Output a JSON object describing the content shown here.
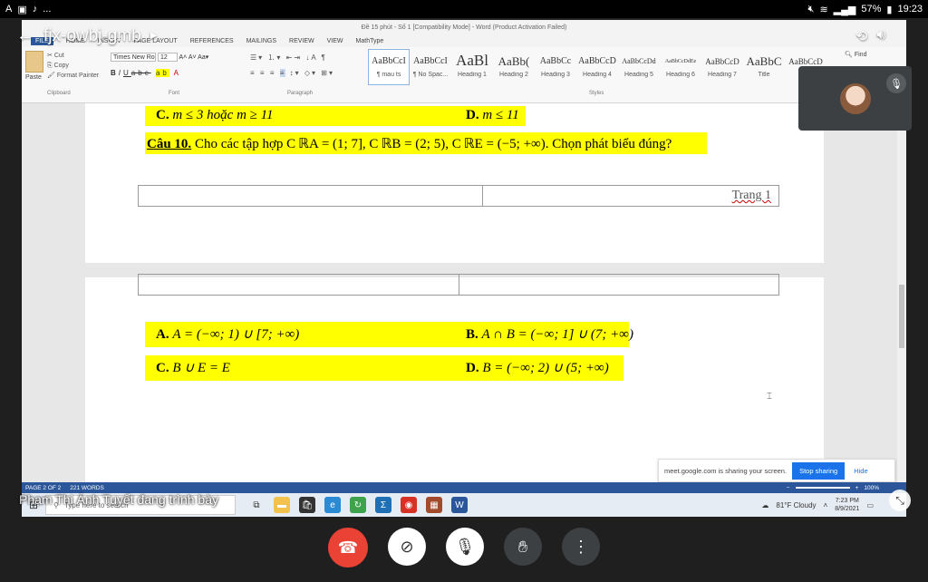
{
  "status_bar": {
    "left_icons": [
      "A",
      "▣",
      "♪",
      "..."
    ],
    "battery": "57%",
    "time": "19:23"
  },
  "meet": {
    "meeting_code": "fjx-owbj-gmb",
    "presenter_text": "Phạm Thị Ánh Tuyết đang trình bày"
  },
  "word": {
    "title": "Đề 15 phút - Số 1 [Compatibility Mode] - Word (Product Activation Failed)",
    "tabs": [
      "FILE",
      "HOME",
      "INSERT",
      "PAGE LAYOUT",
      "REFERENCES",
      "MAILINGS",
      "REVIEW",
      "VIEW",
      "MathType"
    ],
    "clipboard": {
      "paste": "Paste",
      "cut": "Cut",
      "copy": "Copy",
      "format_painter": "Format Painter",
      "label": "Clipboard"
    },
    "font": {
      "name": "Times New Ro",
      "size": "12",
      "label": "Font"
    },
    "paragraph_label": "Paragraph",
    "styles_label": "Styles",
    "styles": [
      {
        "sample": "AaBbCcI",
        "name": "¶ mau ts"
      },
      {
        "sample": "AaBbCcI",
        "name": "¶ No Spac..."
      },
      {
        "sample": "AaBl",
        "name": "Heading 1"
      },
      {
        "sample": "AaBb(",
        "name": "Heading 2"
      },
      {
        "sample": "AaBbCc",
        "name": "Heading 3"
      },
      {
        "sample": "AaBbCcD",
        "name": "Heading 4"
      },
      {
        "sample": "AaBbCcDd",
        "name": "Heading 5"
      },
      {
        "sample": "AaBbCcDdEe",
        "name": "Heading 6"
      },
      {
        "sample": "AaBbCcD",
        "name": "Heading 7"
      },
      {
        "sample": "AaBbC",
        "name": "Title"
      },
      {
        "sample": "AaBbCcD",
        "name": "Su"
      }
    ],
    "find": "Find",
    "page1": {
      "option_c_label": "C.",
      "option_c_text": "m ≤ 3  hoặc  m ≥ 11",
      "option_d_label": "D.",
      "option_d_text": "m ≤ 11",
      "question_label": "Câu 10.",
      "question_text": "Cho các tập hợp C ℝA = (1; 7], C ℝB = (2; 5), C ℝE = (−5; +∞). Chọn phát biểu đúng?",
      "footer_page": "Trang 1"
    },
    "page2": {
      "a_label": "A.",
      "a_text": "A = (−∞; 1) ∪ [7; +∞)",
      "b_label": "B.",
      "b_text": "A ∩ B = (−∞; 1] ∪ (7; +∞)",
      "c_label": "C.",
      "c_text": "B ∪ E = E",
      "d_label": "D.",
      "d_text": "B = (−∞; 2) ∪ (5; +∞)"
    },
    "status": {
      "page": "PAGE 2 OF 2",
      "words": "221 WORDS",
      "zoom": "100%"
    }
  },
  "share_banner": {
    "text": "meet.google.com is sharing your screen.",
    "stop": "Stop sharing",
    "hide": "Hide"
  },
  "taskbar": {
    "search_placeholder": "Type here to search",
    "weather": "81°F  Cloudy",
    "time": "7:23 PM",
    "date": "8/9/2021"
  },
  "colors": {
    "highlight": "#ffff00",
    "word_blue": "#2b579a",
    "end_call": "#ea4335"
  }
}
